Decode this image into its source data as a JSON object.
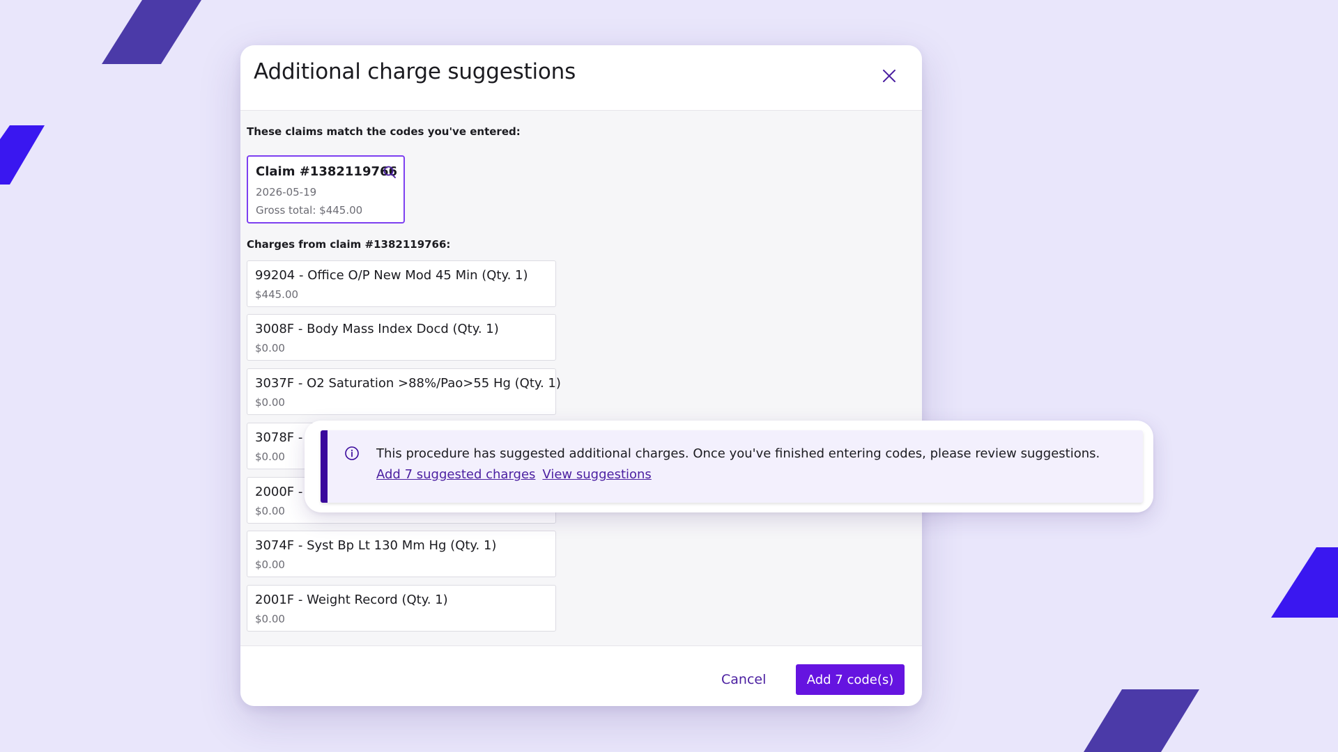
{
  "colors": {
    "background": "#e9e6fb",
    "accent": "#6514e0",
    "accent_dark": "#3a0a9c",
    "link": "#4a1ea0",
    "deco_dark": "#4b3aa8",
    "deco_bright": "#3a17f0"
  },
  "modal": {
    "title": "Additional charge suggestions",
    "close_icon": "close-icon",
    "claims_intro": "These claims match the codes you've entered:",
    "claim": {
      "title": "Claim #1382119766",
      "date": "2026-05-19",
      "gross_total": "Gross total: $445.00",
      "icon": "search-icon"
    },
    "charges_label": "Charges from claim #1382119766:",
    "charges": [
      {
        "name": "99204 - Office O/P New Mod 45 Min (Qty. 1)",
        "price": "$445.00"
      },
      {
        "name": "3008F - Body Mass Index Docd (Qty. 1)",
        "price": "$0.00"
      },
      {
        "name": "3037F - O2 Saturation >88%/Pao>55 Hg (Qty. 1)",
        "price": "$0.00"
      },
      {
        "name": "3078F -",
        "price": "$0.00"
      },
      {
        "name": "2000F -",
        "price": "$0.00"
      },
      {
        "name": "3074F - Syst Bp Lt 130 Mm Hg (Qty. 1)",
        "price": "$0.00"
      },
      {
        "name": "2001F - Weight Record (Qty. 1)",
        "price": "$0.00"
      }
    ],
    "footer": {
      "cancel_label": "Cancel",
      "primary_label": "Add 7 code(s)"
    }
  },
  "alert": {
    "icon": "info-icon",
    "message": "This procedure has suggested additional charges. Once you've finished entering codes, please review suggestions.",
    "add_link": "Add 7 suggested charges",
    "view_link": "View suggestions"
  }
}
